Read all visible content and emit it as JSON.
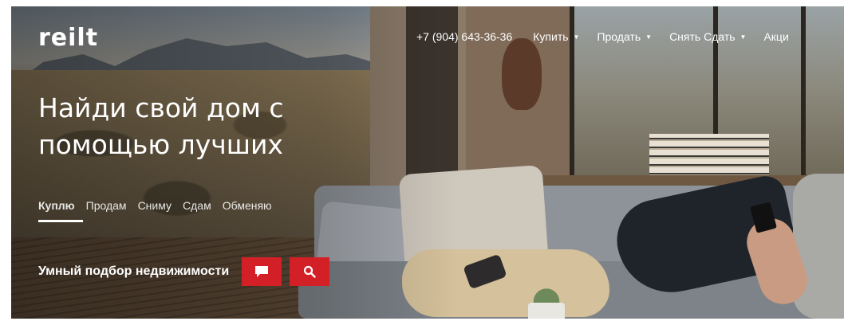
{
  "header": {
    "logo_text": "reilt",
    "phone": "+7 (904) 643-36-36",
    "nav": [
      {
        "label": "Купить"
      },
      {
        "label": "Продать"
      },
      {
        "label": "Снять Сдать"
      },
      {
        "label": "Акци"
      }
    ]
  },
  "hero": {
    "headline_line1": "Найди свой дом с",
    "headline_line2": "помощью лучших",
    "tabs": [
      {
        "label": "Куплю",
        "active": true
      },
      {
        "label": "Продам"
      },
      {
        "label": "Сниму"
      },
      {
        "label": "Сдам"
      },
      {
        "label": "Обменяю"
      }
    ],
    "search_label": "Умный подбор недвижимости"
  },
  "icons": {
    "chat": "chat-icon",
    "search": "search-icon",
    "caret": "caret-down-icon"
  },
  "colors": {
    "accent": "#d32027",
    "text": "#ffffff"
  }
}
